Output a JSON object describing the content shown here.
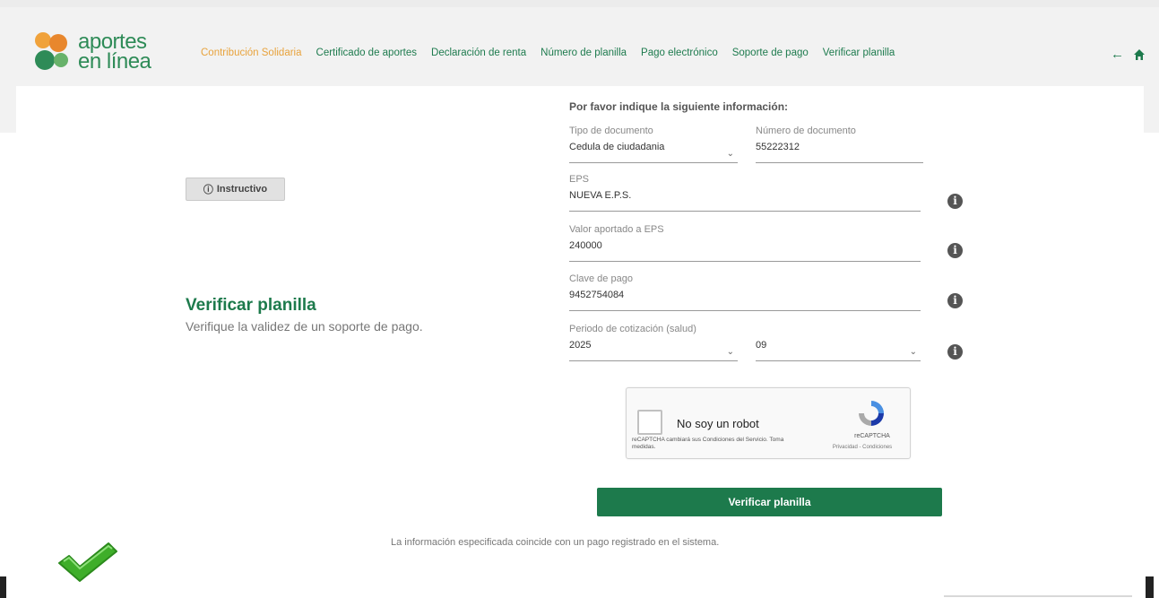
{
  "logo": {
    "line1": "aportes",
    "line2": "en línea"
  },
  "nav": {
    "items": [
      {
        "label": "Contribución Solidaria"
      },
      {
        "label": "Certificado de aportes"
      },
      {
        "label": "Declaración de renta"
      },
      {
        "label": "Número de planilla"
      },
      {
        "label": "Pago electrónico"
      },
      {
        "label": "Soporte de pago"
      },
      {
        "label": "Verificar planilla"
      }
    ],
    "icons": [
      "arrow-left-icon",
      "home-icon"
    ]
  },
  "left": {
    "instructivo_label": "Instructivo",
    "title": "Verificar planilla",
    "subtitle": "Verifique la validez de un soporte de pago."
  },
  "form": {
    "intro": "Por favor indique la siguiente información:",
    "doc_type": {
      "label": "Tipo de documento",
      "value": "Cedula de ciudadania"
    },
    "doc_number": {
      "label": "Número de documento",
      "value": "55222312"
    },
    "eps": {
      "label": "EPS",
      "value": "NUEVA E.P.S."
    },
    "valor": {
      "label": "Valor aportado a EPS",
      "value": "240000"
    },
    "clave": {
      "label": "Clave de pago",
      "value": "9452754084"
    },
    "periodo": {
      "label": "Periodo de cotización (salud)",
      "year": "2025",
      "month": "09"
    }
  },
  "captcha": {
    "label": "No soy un robot",
    "terms": "reCAPTCHA cambiará sus Condiciones del Servicio. Toma medidas.",
    "brand": "reCAPTCHA",
    "privacy": "Privacidad - Condiciones"
  },
  "verify_button": "Verificar planilla",
  "result_message": "La información especificada coincide con un pago registrado en el sistema.",
  "colors": {
    "brand_green": "#1d7a4c",
    "nav_active": "#e8a33d"
  }
}
